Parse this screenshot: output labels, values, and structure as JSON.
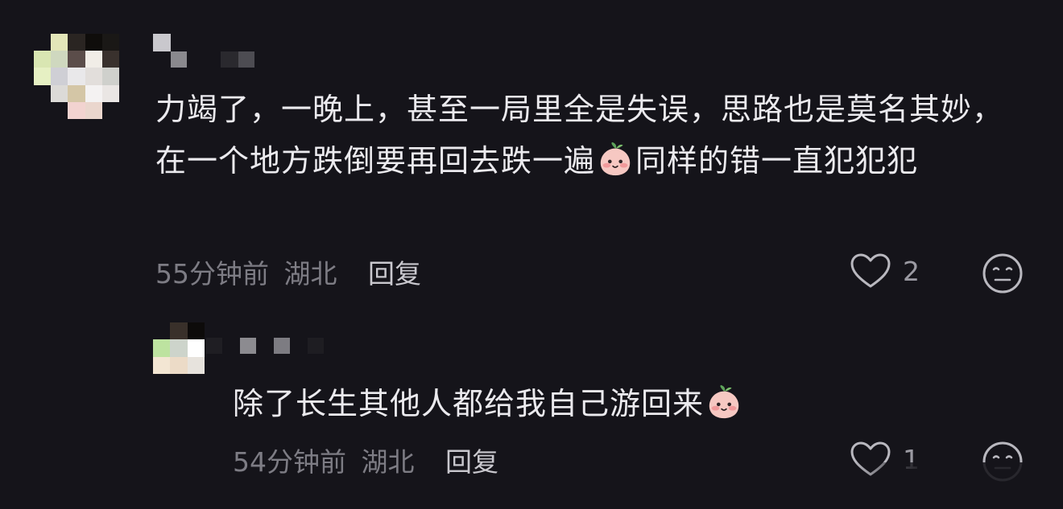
{
  "comments": [
    {
      "text_before_emoji": "力竭了，一晚上，甚至一局里全是失误，思路也是莫名其妙，在一个地方跌倒要再回去跌一遍",
      "text_after_emoji": "同样的错一直犯犯犯",
      "emoji_icon": "blushing-peach-emoji",
      "time": "55分钟前",
      "location": "湖北",
      "reply_label": "回复",
      "likes": "2",
      "avatar_colors": [
        "#15141a",
        "#e3e6b8",
        "#2a2522",
        "#0f0d0b",
        "#1a1816",
        "#d9e6b2",
        "#cfd8bf",
        "#5b4d4a",
        "#f1ede7",
        "#39312d",
        "#e6f0c3",
        "#cfcfd5",
        "#e9e8ea",
        "#e2dedb",
        "#cfd0cc",
        "#15141a",
        "#dcdad7",
        "#d4c6a6",
        "#f4f2f2",
        "#eae6e4",
        "#15141a",
        "#15141a",
        "#f2d3d0",
        "#ead6cd",
        "#15141a"
      ]
    },
    {
      "text_before_emoji": "除了长生其他人都给我自己游回来",
      "text_after_emoji": "",
      "emoji_icon": "blushing-peach-emoji",
      "time": "54分钟前",
      "location": "湖北",
      "reply_label": "回复",
      "likes": "1",
      "avatar_colors": [
        "#15141a",
        "#39302a",
        "#0d0b0a",
        "#bde3a0",
        "#cdd4cb",
        "#ffffff",
        "#f3e6d3",
        "#ecdbc7",
        "#e7e3dd"
      ]
    }
  ],
  "colors": {
    "background": "#15141a",
    "text": "#ebeaee",
    "meta": "#7d7c84",
    "reply": "#c9c8ce",
    "icon": "#b9b8bf"
  }
}
